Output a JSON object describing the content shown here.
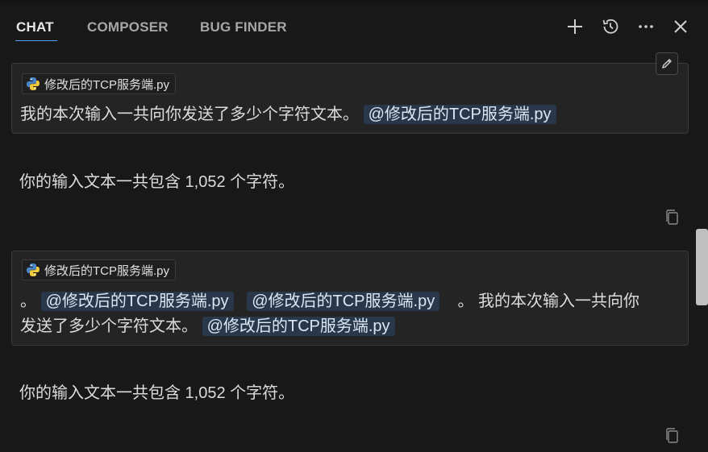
{
  "tabs": [
    {
      "label": "CHAT",
      "active": true
    },
    {
      "label": "COMPOSER",
      "active": false
    },
    {
      "label": "BUG FINDER",
      "active": false
    }
  ],
  "toolbar_icons": [
    "plus-icon",
    "history-icon",
    "more-icon",
    "close-icon"
  ],
  "messages": [
    {
      "attachment": "修改后的TCP服务端.py",
      "text_before": "我的本次输入一共向你发送了多少个字符文本。",
      "mention": "@修改后的TCP服务端.py",
      "reply": "你的输入文本一共包含 1,052 个字符。"
    },
    {
      "attachment": "修改后的TCP服务端.py",
      "line1_prefix": "。",
      "mention1": "@修改后的TCP服务端.py",
      "mention2": "@修改后的TCP服务端.py",
      "line1_suffix": "。 我的本次输入一共向你",
      "line2_text": "发送了多少个字符文本。",
      "mention3": "@修改后的TCP服务端.py",
      "reply": "你的输入文本一共包含 1,052 个字符。"
    }
  ],
  "colors": {
    "background": "#181818",
    "card": "#242424",
    "mention_bg": "#28384a",
    "accent": "#4da3ff"
  }
}
